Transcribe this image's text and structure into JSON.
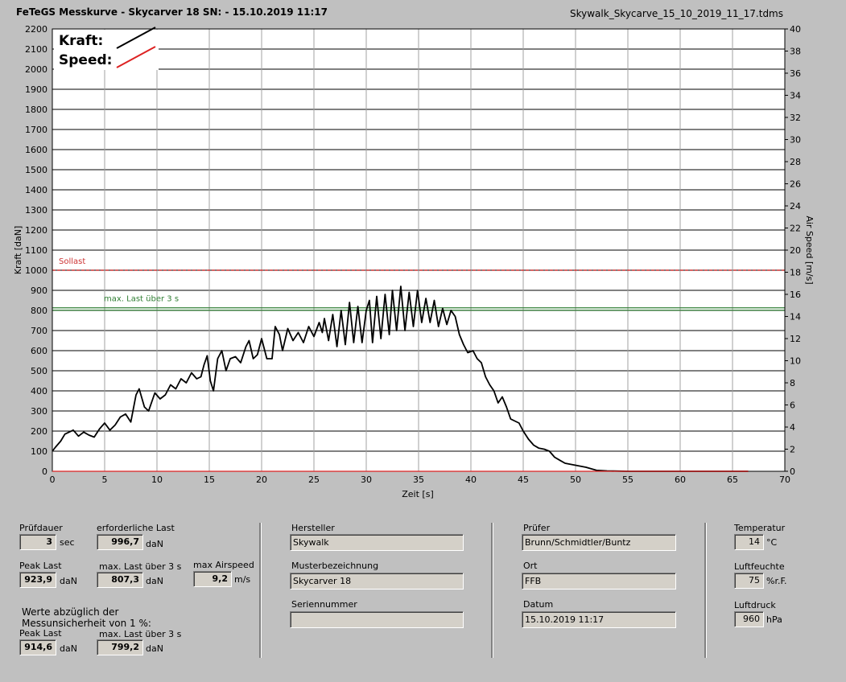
{
  "header": {
    "title": "FeTeGS Messkurve - Skycarver 18  SN:  - 15.10.2019 11:17",
    "filename": "Skywalk_Skycarve_15_10_2019_11_17.tdms"
  },
  "chart_data": {
    "type": "line",
    "xlabel": "Zeit [s]",
    "ylabel": "Kraft [daN]",
    "y2label": "Air Speed [m/s]",
    "xlim": [
      0,
      70
    ],
    "ylim": [
      0,
      2200
    ],
    "y2lim": [
      0,
      40
    ],
    "x_ticks": [
      0,
      5,
      10,
      15,
      20,
      25,
      30,
      35,
      40,
      45,
      50,
      55,
      60,
      65,
      70
    ],
    "y_ticks": [
      0,
      100,
      200,
      300,
      400,
      500,
      600,
      700,
      800,
      900,
      1000,
      1100,
      1200,
      1300,
      1400,
      1500,
      1600,
      1700,
      1800,
      1900,
      2000,
      2100,
      2200
    ],
    "y2_ticks": [
      0,
      2,
      4,
      6,
      8,
      10,
      12,
      14,
      16,
      18,
      20,
      22,
      24,
      26,
      28,
      30,
      32,
      34,
      36,
      38,
      40
    ],
    "legend": [
      {
        "name": "Kraft:",
        "color": "#000000"
      },
      {
        "name": "Speed:",
        "color": "#dd2222"
      }
    ],
    "reference_lines": [
      {
        "label": "Sollast",
        "y": 1000,
        "color": "#cc3333"
      },
      {
        "label": "max. Last über  3 s",
        "y": 807,
        "color": "#2e7d32"
      }
    ],
    "series": [
      {
        "name": "Kraft:",
        "color": "#000000",
        "points": [
          [
            0,
            100
          ],
          [
            0.3,
            120
          ],
          [
            0.8,
            150
          ],
          [
            1.2,
            185
          ],
          [
            2,
            205
          ],
          [
            2.5,
            175
          ],
          [
            3,
            195
          ],
          [
            3.5,
            180
          ],
          [
            4,
            170
          ],
          [
            4.5,
            210
          ],
          [
            5,
            240
          ],
          [
            5.5,
            205
          ],
          [
            6,
            230
          ],
          [
            6.5,
            270
          ],
          [
            7,
            285
          ],
          [
            7.5,
            245
          ],
          [
            8,
            380
          ],
          [
            8.3,
            410
          ],
          [
            8.8,
            320
          ],
          [
            9.2,
            300
          ],
          [
            9.8,
            390
          ],
          [
            10.3,
            360
          ],
          [
            10.8,
            380
          ],
          [
            11.3,
            430
          ],
          [
            11.8,
            410
          ],
          [
            12.3,
            460
          ],
          [
            12.8,
            440
          ],
          [
            13.3,
            490
          ],
          [
            13.8,
            460
          ],
          [
            14.2,
            470
          ],
          [
            14.5,
            530
          ],
          [
            14.8,
            575
          ],
          [
            15.1,
            450
          ],
          [
            15.4,
            400
          ],
          [
            15.8,
            560
          ],
          [
            16.2,
            600
          ],
          [
            16.6,
            500
          ],
          [
            17,
            560
          ],
          [
            17.5,
            570
          ],
          [
            18,
            540
          ],
          [
            18.5,
            620
          ],
          [
            18.8,
            650
          ],
          [
            19.2,
            560
          ],
          [
            19.6,
            580
          ],
          [
            20,
            660
          ],
          [
            20.5,
            560
          ],
          [
            21,
            560
          ],
          [
            21.3,
            720
          ],
          [
            21.7,
            680
          ],
          [
            22,
            600
          ],
          [
            22.5,
            710
          ],
          [
            23,
            650
          ],
          [
            23.5,
            690
          ],
          [
            24,
            640
          ],
          [
            24.5,
            720
          ],
          [
            25,
            670
          ],
          [
            25.5,
            740
          ],
          [
            25.8,
            690
          ],
          [
            26,
            760
          ],
          [
            26.4,
            650
          ],
          [
            26.8,
            780
          ],
          [
            27.2,
            620
          ],
          [
            27.6,
            800
          ],
          [
            28,
            630
          ],
          [
            28.4,
            840
          ],
          [
            28.8,
            640
          ],
          [
            29.2,
            820
          ],
          [
            29.6,
            640
          ],
          [
            30,
            800
          ],
          [
            30.3,
            850
          ],
          [
            30.6,
            640
          ],
          [
            31,
            870
          ],
          [
            31.4,
            660
          ],
          [
            31.8,
            880
          ],
          [
            32.2,
            680
          ],
          [
            32.5,
            900
          ],
          [
            32.9,
            700
          ],
          [
            33.3,
            920
          ],
          [
            33.7,
            700
          ],
          [
            34.1,
            890
          ],
          [
            34.5,
            720
          ],
          [
            34.9,
            900
          ],
          [
            35.3,
            740
          ],
          [
            35.7,
            860
          ],
          [
            36.1,
            740
          ],
          [
            36.5,
            850
          ],
          [
            36.9,
            720
          ],
          [
            37.3,
            810
          ],
          [
            37.7,
            730
          ],
          [
            38.1,
            800
          ],
          [
            38.5,
            770
          ],
          [
            38.9,
            680
          ],
          [
            39.3,
            630
          ],
          [
            39.7,
            590
          ],
          [
            40.2,
            600
          ],
          [
            40.6,
            560
          ],
          [
            41,
            540
          ],
          [
            41.4,
            470
          ],
          [
            41.8,
            430
          ],
          [
            42.2,
            400
          ],
          [
            42.6,
            340
          ],
          [
            43,
            370
          ],
          [
            43.4,
            320
          ],
          [
            43.8,
            260
          ],
          [
            44.2,
            250
          ],
          [
            44.6,
            240
          ],
          [
            45,
            200
          ],
          [
            45.5,
            160
          ],
          [
            46,
            130
          ],
          [
            46.5,
            115
          ],
          [
            47,
            110
          ],
          [
            47.5,
            100
          ],
          [
            48,
            70
          ],
          [
            48.5,
            55
          ],
          [
            49,
            40
          ],
          [
            50,
            30
          ],
          [
            51,
            20
          ],
          [
            52,
            5
          ],
          [
            53,
            2
          ],
          [
            55,
            0
          ],
          [
            66.5,
            0
          ]
        ]
      },
      {
        "name": "Speed:",
        "color": "#dd2222",
        "points": [
          [
            0,
            0
          ],
          [
            66.5,
            0
          ]
        ]
      }
    ]
  },
  "results": {
    "pruefdauer": {
      "label": "Prüfdauer",
      "value": "3",
      "unit": "sec"
    },
    "erforderliche_last": {
      "label": "erforderliche Last",
      "value": "996,7",
      "unit": "daN"
    },
    "peak_last": {
      "label": "Peak Last",
      "value": "923,9",
      "unit": "daN"
    },
    "max_last": {
      "label": "max. Last über  3 s",
      "value": "807,3",
      "unit": "daN"
    },
    "max_airspeed": {
      "label": "max Airspeed",
      "value": "9,2",
      "unit": "m/s"
    },
    "werte_note_line1": "Werte abzüglich der",
    "werte_note_line2": "Messunsicherheit von 1  %:",
    "peak_last_corr": {
      "label": "Peak Last",
      "value": "914,6",
      "unit": "daN"
    },
    "max_last_corr": {
      "label": "max. Last über  3 s",
      "value": "799,2",
      "unit": "daN"
    }
  },
  "info": {
    "hersteller": {
      "label": "Hersteller",
      "value": "Skywalk"
    },
    "musterbezeichnung": {
      "label": "Musterbezeichnung",
      "value": "Skycarver 18"
    },
    "seriennummer": {
      "label": "Seriennummer",
      "value": ""
    },
    "pruefer": {
      "label": "Prüfer",
      "value": "Brunn/Schmidtler/Buntz"
    },
    "ort": {
      "label": "Ort",
      "value": "FFB"
    },
    "datum": {
      "label": "Datum",
      "value": "15.10.2019 11:17"
    }
  },
  "environment": {
    "temperatur": {
      "label": "Temperatur",
      "value": "14",
      "unit": "°C"
    },
    "luftfeuchte": {
      "label": "Luftfeuchte",
      "value": "75",
      "unit": "%r.F."
    },
    "luftdruck": {
      "label": "Luftdruck",
      "value": "960",
      "unit": "hPa"
    }
  }
}
